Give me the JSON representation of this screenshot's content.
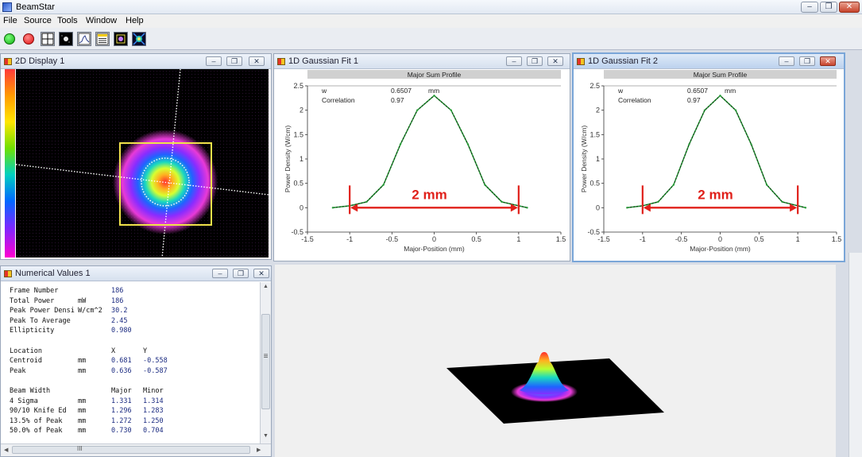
{
  "app": {
    "title": "BeamStar",
    "window_buttons": [
      "–",
      "❐",
      "✕"
    ]
  },
  "menu": [
    "File",
    "Source",
    "Tools",
    "Window",
    "Help"
  ],
  "toolbar_icons": [
    "start-green-icon",
    "record-red-icon",
    "grid-display-icon",
    "2d-beam-icon",
    "profile-icon",
    "numerical-values-icon",
    "spot-icon",
    "3d-view-icon"
  ],
  "colors": {
    "accent_red": "#e0201a",
    "fit_green": "#2a9e3a",
    "roi_yellow": "#f0e24a",
    "mdi_active_border": "#7aa6d8"
  },
  "display2d": {
    "title": "2D Display 1"
  },
  "gauss1": {
    "title": "1D Gaussian Fit 1",
    "plot_title": "Major Sum Profile",
    "w_label": "w",
    "w_value": "0.6507",
    "w_unit": "mm",
    "corr_label": "Correlation",
    "corr_value": "0.97",
    "ylabel": "Power Density (W/cm)",
    "xlabel": "Major-Position (mm)",
    "annotation": "2 mm"
  },
  "gauss2": {
    "title": "1D Gaussian Fit 2",
    "plot_title": "Major Sum Profile",
    "w_label": "w",
    "w_value": "0.6507",
    "w_unit": "mm",
    "corr_label": "Correlation",
    "corr_value": "0.97",
    "ylabel": "Power Density (W/cm)",
    "xlabel": "Major-Position (mm)",
    "annotation": "2 mm"
  },
  "chart_data": [
    {
      "type": "line",
      "title": "Major Sum Profile",
      "xlabel": "Major-Position (mm)",
      "ylabel": "Power Density (W/cm)",
      "xlim": [
        -1.5,
        1.5
      ],
      "ylim": [
        -0.5,
        2.5
      ],
      "xticks": [
        "-1.5",
        "-1",
        "-0.5",
        "0",
        "0.5",
        "1",
        "1.5"
      ],
      "yticks": [
        "-0.5",
        "0",
        "0.5",
        "1",
        "1.5",
        "2",
        "2.5"
      ],
      "x": [
        -1.2,
        -1.0,
        -0.8,
        -0.6,
        -0.4,
        -0.2,
        0.0,
        0.2,
        0.4,
        0.6,
        0.8,
        1.0,
        1.1
      ],
      "y": [
        0.0,
        0.04,
        0.12,
        0.47,
        1.3,
        2.0,
        2.3,
        2.0,
        1.3,
        0.47,
        0.12,
        0.04,
        0.0
      ],
      "annotation_span": [
        -1,
        1
      ]
    },
    {
      "type": "line",
      "title": "Major Sum Profile",
      "xlabel": "Major-Position (mm)",
      "ylabel": "Power Density (W/cm)",
      "xlim": [
        -1.5,
        1.5
      ],
      "ylim": [
        -0.5,
        2.5
      ],
      "xticks": [
        "-1.5",
        "-1",
        "-0.5",
        "0",
        "0.5",
        "1",
        "1.5"
      ],
      "yticks": [
        "-0.5",
        "0",
        "0.5",
        "1",
        "1.5",
        "2",
        "2.5"
      ],
      "x": [
        -1.2,
        -1.0,
        -0.8,
        -0.6,
        -0.4,
        -0.2,
        0.0,
        0.2,
        0.4,
        0.6,
        0.8,
        1.0,
        1.1
      ],
      "y": [
        0.0,
        0.04,
        0.12,
        0.47,
        1.3,
        2.0,
        2.3,
        2.0,
        1.3,
        0.47,
        0.12,
        0.04,
        0.0
      ],
      "annotation_span": [
        -1,
        1
      ]
    }
  ],
  "numerical": {
    "title": "Numerical Values 1",
    "scroll_mid": "≡",
    "hscroll_mid": "III",
    "rows": [
      [
        "Frame Number",
        "",
        "186",
        ""
      ],
      [
        "Total Power",
        "mW",
        "186",
        ""
      ],
      [
        "Peak Power Densi",
        "W/cm^2",
        "30.2",
        ""
      ],
      [
        "Peak To Average",
        "",
        "2.45",
        ""
      ],
      [
        "Ellipticity",
        "",
        "0.980",
        ""
      ],
      [
        "",
        "",
        "",
        ""
      ],
      [
        "Location",
        "",
        "X",
        "Y"
      ],
      [
        "  Centroid",
        "mm",
        "0.681",
        "-0.558"
      ],
      [
        "  Peak",
        "mm",
        "0.636",
        "-0.587"
      ],
      [
        "",
        "",
        "",
        ""
      ],
      [
        "Beam Width",
        "",
        "Major",
        "Minor"
      ],
      [
        "  4 Sigma",
        "mm",
        "1.331",
        "1.314"
      ],
      [
        "  90/10 Knife Ed",
        "mm",
        "1.296",
        "1.283"
      ],
      [
        "  13.5% of Peak",
        "mm",
        "1.272",
        "1.250"
      ],
      [
        "  50.0% of Peak",
        "mm",
        "0.730",
        "0.704"
      ]
    ]
  }
}
